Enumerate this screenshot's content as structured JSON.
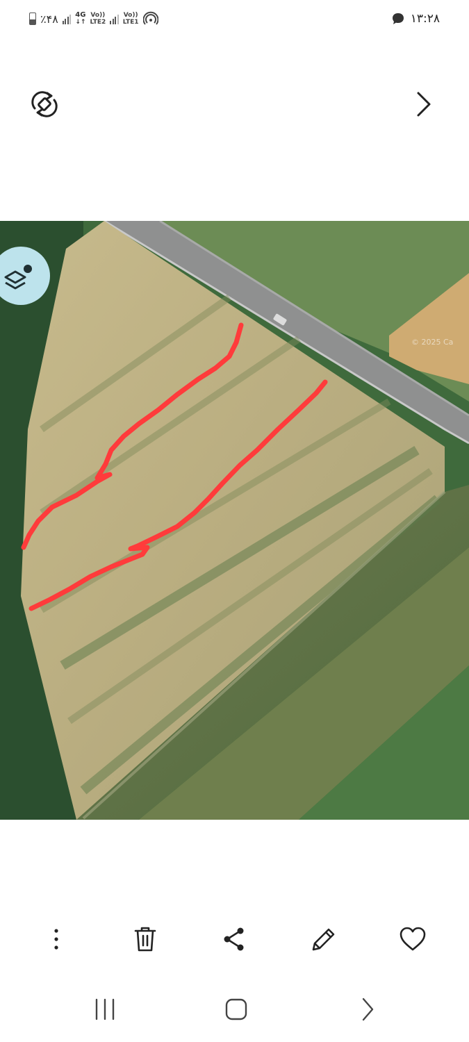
{
  "status_bar": {
    "battery_text": "٪۴۸",
    "network_4g": "4G",
    "volte2_top": "Vo))",
    "volte2_bottom": "LTE2",
    "volte1_top": "Vo))",
    "volte1_bottom": "LTE1",
    "time": "۱۳:۲۸"
  },
  "photo": {
    "watermark": "© 2025 Ca",
    "drawn_line_color": "#ff3b3b"
  },
  "icons": {
    "rotate": "auto-rotate-icon",
    "next": "chevron-right-icon",
    "layers": "layers-icon",
    "more": "more-vertical-icon",
    "delete": "trash-icon",
    "share": "share-icon",
    "edit": "pencil-icon",
    "favorite": "heart-icon",
    "recents": "recents-icon",
    "home": "home-icon",
    "back": "back-icon"
  }
}
